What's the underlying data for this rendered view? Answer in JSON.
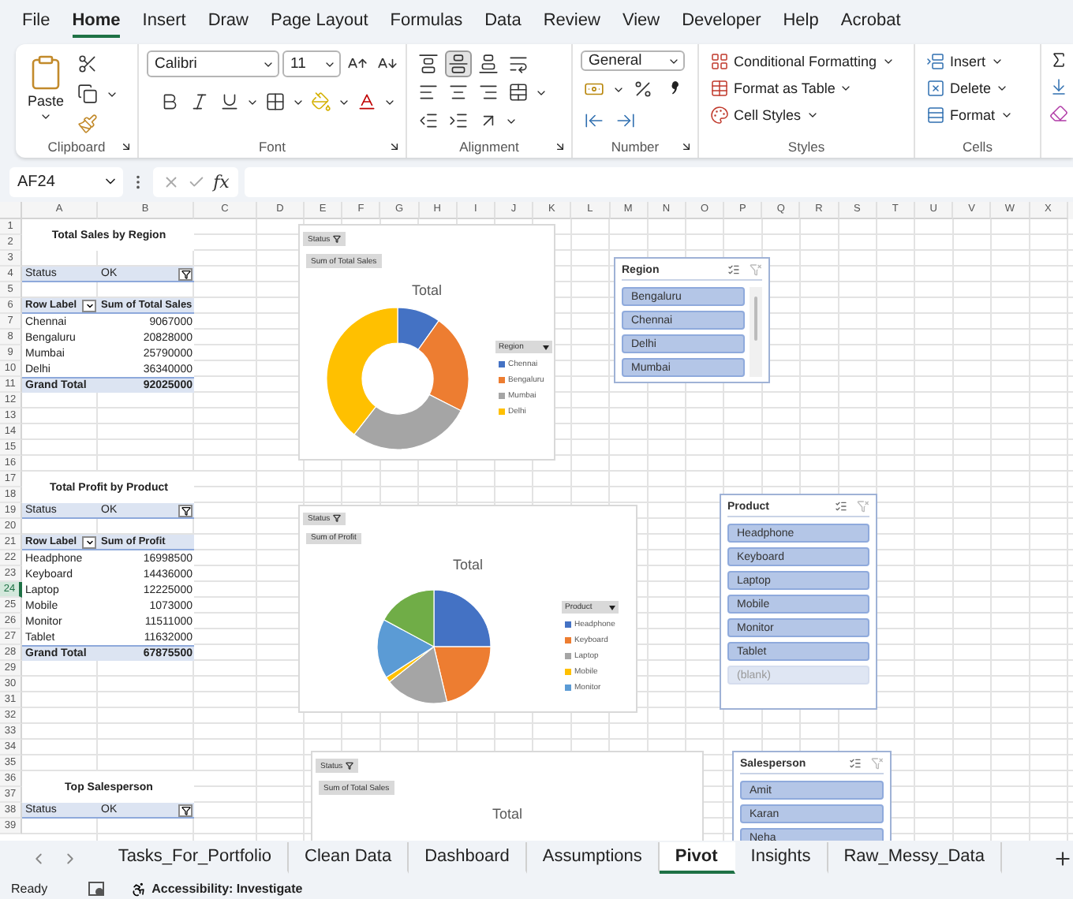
{
  "menu_tabs": [
    {
      "label": "File",
      "selected": false
    },
    {
      "label": "Home",
      "selected": true
    },
    {
      "label": "Insert",
      "selected": false
    },
    {
      "label": "Draw",
      "selected": false
    },
    {
      "label": "Page Layout",
      "selected": false
    },
    {
      "label": "Formulas",
      "selected": false
    },
    {
      "label": "Data",
      "selected": false
    },
    {
      "label": "Review",
      "selected": false
    },
    {
      "label": "View",
      "selected": false
    },
    {
      "label": "Developer",
      "selected": false
    },
    {
      "label": "Help",
      "selected": false
    },
    {
      "label": "Acrobat",
      "selected": false
    }
  ],
  "ribbon": {
    "clipboard": {
      "label": "Clipboard",
      "paste": "Paste"
    },
    "font": {
      "label": "Font",
      "font_name": "Calibri",
      "font_size": "11"
    },
    "alignment": {
      "label": "Alignment",
      "vertical_align_buttons": [
        {
          "selected": false
        },
        {
          "selected": true
        },
        {
          "selected": false
        }
      ]
    },
    "number": {
      "label": "Number",
      "format": "General"
    },
    "styles": {
      "label": "Styles",
      "buttons": [
        "Conditional Formatting",
        "Format as Table",
        "Cell Styles"
      ]
    },
    "cells": {
      "label": "Cells",
      "buttons": [
        "Insert",
        "Delete",
        "Format"
      ]
    }
  },
  "formula_bar": {
    "name_box": "AF24",
    "function_label": "fx"
  },
  "sheet": {
    "columns": [
      "A",
      "B",
      "C",
      "D",
      "E",
      "F",
      "G",
      "H",
      "I",
      "J",
      "K",
      "L",
      "M",
      "N",
      "O",
      "P",
      "Q",
      "R",
      "S",
      "T",
      "U",
      "V",
      "W",
      "X"
    ],
    "rows": [
      {
        "label": "1",
        "selected": false
      },
      {
        "label": "2",
        "selected": false
      },
      {
        "label": "3",
        "selected": false
      },
      {
        "label": "4",
        "selected": false
      },
      {
        "label": "5",
        "selected": false
      },
      {
        "label": "6",
        "selected": false
      },
      {
        "label": "7",
        "selected": false
      },
      {
        "label": "8",
        "selected": false
      },
      {
        "label": "9",
        "selected": false
      },
      {
        "label": "10",
        "selected": false
      },
      {
        "label": "11",
        "selected": false
      },
      {
        "label": "12",
        "selected": false
      },
      {
        "label": "13",
        "selected": false
      },
      {
        "label": "14",
        "selected": false
      },
      {
        "label": "15",
        "selected": false
      },
      {
        "label": "16",
        "selected": false
      },
      {
        "label": "17",
        "selected": false
      },
      {
        "label": "18",
        "selected": false
      },
      {
        "label": "19",
        "selected": false
      },
      {
        "label": "20",
        "selected": false
      },
      {
        "label": "21",
        "selected": false
      },
      {
        "label": "22",
        "selected": false
      },
      {
        "label": "23",
        "selected": false
      },
      {
        "label": "24",
        "selected": true
      },
      {
        "label": "25",
        "selected": false
      },
      {
        "label": "26",
        "selected": false
      },
      {
        "label": "27",
        "selected": false
      },
      {
        "label": "28",
        "selected": false
      },
      {
        "label": "29",
        "selected": false
      },
      {
        "label": "30",
        "selected": false
      },
      {
        "label": "31",
        "selected": false
      },
      {
        "label": "32",
        "selected": false
      },
      {
        "label": "33",
        "selected": false
      },
      {
        "label": "34",
        "selected": false
      },
      {
        "label": "35",
        "selected": false
      },
      {
        "label": "36",
        "selected": false
      },
      {
        "label": "37",
        "selected": false
      },
      {
        "label": "38",
        "selected": false
      },
      {
        "label": "39",
        "selected": false
      }
    ]
  },
  "pivot_tables": [
    {
      "title": "Total Sales by Region",
      "filter": {
        "label": "Status",
        "value": "OK"
      },
      "header": {
        "row_label": "Row Label",
        "value_label": "Sum of Total Sales"
      },
      "rows": [
        {
          "label": "Chennai",
          "value": "9067000"
        },
        {
          "label": "Bengaluru",
          "value": "20828000"
        },
        {
          "label": "Mumbai",
          "value": "25790000"
        },
        {
          "label": "Delhi",
          "value": "36340000"
        }
      ],
      "total": {
        "label": "Grand Total",
        "value": "92025000"
      }
    },
    {
      "title": "Total Profit by Product",
      "filter": {
        "label": "Status",
        "value": "OK"
      },
      "header": {
        "row_label": "Row Label",
        "value_label": "Sum of Profit"
      },
      "rows": [
        {
          "label": "Headphone",
          "value": "16998500"
        },
        {
          "label": "Keyboard",
          "value": "14436000"
        },
        {
          "label": "Laptop",
          "value": "12225000"
        },
        {
          "label": "Mobile",
          "value": "1073000"
        },
        {
          "label": "Monitor",
          "value": "11511000"
        },
        {
          "label": "Tablet",
          "value": "11632000"
        }
      ],
      "total": {
        "label": "Grand Total",
        "value": "67875500"
      }
    },
    {
      "title": "Top Salesperson",
      "filter": {
        "label": "Status",
        "value": "OK"
      }
    }
  ],
  "pivot_charts": [
    {
      "kind": "donut",
      "filter_button": "Status",
      "value_button": "Sum of Total Sales",
      "title": "Total",
      "legend_title": "Region",
      "legend": [
        "Chennai",
        "Bengaluru",
        "Mumbai",
        "Delhi"
      ],
      "slices": [
        {
          "color": "#4472c4"
        },
        {
          "color": "#ed7d31"
        },
        {
          "color": "#a5a5a5"
        },
        {
          "color": "#ffc000"
        }
      ]
    },
    {
      "kind": "pie",
      "filter_button": "Status",
      "value_button": "Sum of Profit",
      "title": "Total",
      "legend_title": "Product",
      "legend": [
        "Headphone",
        "Keyboard",
        "Laptop",
        "Mobile",
        "Monitor"
      ],
      "slices": [
        {
          "color": "#4472c4"
        },
        {
          "color": "#ed7d31"
        },
        {
          "color": "#a5a5a5"
        },
        {
          "color": "#ffc000"
        },
        {
          "color": "#5b9bd5"
        },
        {
          "color": "#70ad47"
        }
      ]
    },
    {
      "filter_button": "Status",
      "value_button": "Sum of Total Sales",
      "title": "Total"
    }
  ],
  "slicers": [
    {
      "title": "Region",
      "scrollbar": true,
      "items": [
        {
          "label": "Bengaluru",
          "selected": true
        },
        {
          "label": "Chennai",
          "selected": true
        },
        {
          "label": "Delhi",
          "selected": true
        },
        {
          "label": "Mumbai",
          "selected": true
        }
      ]
    },
    {
      "title": "Product",
      "items": [
        {
          "label": "Headphone",
          "selected": true
        },
        {
          "label": "Keyboard",
          "selected": true
        },
        {
          "label": "Laptop",
          "selected": true
        },
        {
          "label": "Mobile",
          "selected": true
        },
        {
          "label": "Monitor",
          "selected": true
        },
        {
          "label": "Tablet",
          "selected": true
        },
        {
          "label": "(blank)",
          "selected": false
        }
      ]
    },
    {
      "title": "Salesperson",
      "items": [
        {
          "label": "Amit",
          "selected": true
        },
        {
          "label": "Karan",
          "selected": true
        },
        {
          "label": "Neha",
          "selected": true
        }
      ]
    }
  ],
  "sheet_tabs": [
    {
      "label": "Tasks_For_Portfolio",
      "selected": false
    },
    {
      "label": "Clean Data",
      "selected": false
    },
    {
      "label": "Dashboard",
      "selected": false
    },
    {
      "label": "Assumptions",
      "selected": false
    },
    {
      "label": "Pivot",
      "selected": true
    },
    {
      "label": "Insights",
      "selected": false
    },
    {
      "label": "Raw_Messy_Data",
      "selected": false
    }
  ],
  "status_bar": {
    "ready": "Ready",
    "accessibility": "Accessibility: Investigate"
  }
}
